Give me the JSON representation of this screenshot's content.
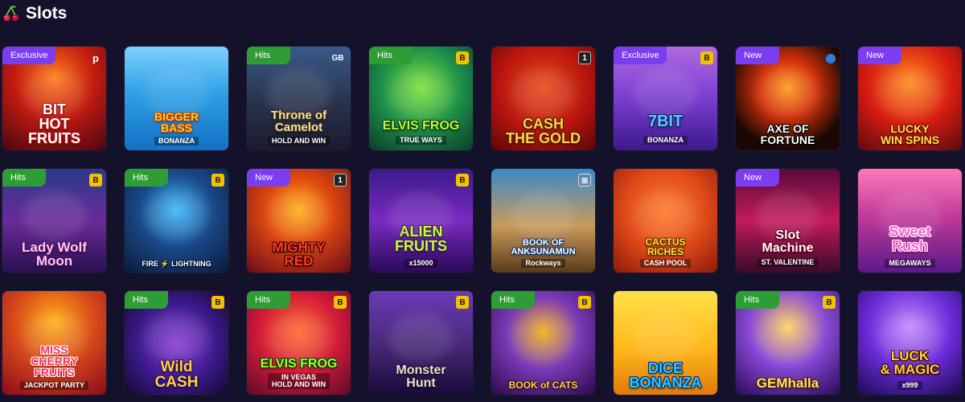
{
  "section": {
    "title": "Slots",
    "icon": "cherry-icon"
  },
  "games": [
    {
      "title": "BIT\nHOT\nFRUITS",
      "subtitle": "",
      "badge": "Exclusive",
      "badge_type": "exclusive",
      "provider_mark": "p",
      "provider_type": "p",
      "bg": "radial-gradient(circle at 50% 30%,#ff7a1a 0%,#c21b10 45%,#4a0612 100%)",
      "title_color": "#ffffff",
      "title_stroke": "#b01010",
      "title_size": "18px"
    },
    {
      "title": "BIGGER\nBASS",
      "subtitle": "BONANZA",
      "badge": "",
      "badge_type": "",
      "provider_mark": "",
      "provider_type": "",
      "bg": "linear-gradient(180deg,#7fd0ff 0%,#2ea0e6 45%,#1270c4 100%)",
      "title_color": "#ffcc33",
      "title_stroke": "#b0400a",
      "title_size": "14px"
    },
    {
      "title": "Throne of\nCamelot",
      "subtitle": "HOLD AND WIN",
      "badge": "Hits",
      "badge_type": "hits",
      "provider_mark": "GB",
      "provider_type": "gb",
      "bg": "linear-gradient(180deg,#3a5a8a 0%,#2a3550 50%,#1a1a2e 100%)",
      "title_color": "#f3e2b0",
      "title_stroke": "#3a2a10",
      "title_size": "15px"
    },
    {
      "title": "ELVIS FROG",
      "subtitle": "TRUE WAYS",
      "badge": "Hits",
      "badge_type": "hits",
      "provider_mark": "B",
      "provider_type": "b",
      "bg": "radial-gradient(circle at 50% 40%,#7ce33a 0%,#1d8f4a 50%,#0d3a2a 100%)",
      "title_color": "#b8ff3a",
      "title_stroke": "#0a3a12",
      "title_size": "16px"
    },
    {
      "title": "CASH\nTHE GOLD",
      "subtitle": "",
      "badge": "",
      "badge_type": "",
      "provider_mark": "1",
      "provider_type": "one",
      "bg": "radial-gradient(circle at 50% 40%,#e84a1a 0%,#b8140e 55%,#5a0608 100%)",
      "title_color": "#ffd34a",
      "title_stroke": "#5a1a00",
      "title_size": "18px"
    },
    {
      "title": "7BIT",
      "subtitle": "BONANZA",
      "badge": "Exclusive",
      "badge_type": "exclusive",
      "provider_mark": "B",
      "provider_type": "b",
      "bg": "linear-gradient(180deg,#b06ae0 0%,#7a3dd0 50%,#3d1a8a 100%)",
      "title_color": "#5ec8ff",
      "title_stroke": "#10206a",
      "title_size": "20px"
    },
    {
      "title": "AXE OF\nFORTUNE",
      "subtitle": "",
      "badge": "New",
      "badge_type": "new",
      "provider_mark": "",
      "provider_type": "dot",
      "bg": "radial-gradient(circle at 50% 40%,#ff9a1a 0%,#d2300a 35%,#1a0804 75%)",
      "title_color": "#ffffff",
      "title_stroke": "#000000",
      "title_size": "14px"
    },
    {
      "title": "LUCKY\nWIN SPINS",
      "subtitle": "",
      "badge": "New",
      "badge_type": "new",
      "provider_mark": "",
      "provider_type": "",
      "bg": "radial-gradient(circle at 50% 35%,#ff8a1a 0%,#d81c12 50%,#5a0a10 100%)",
      "title_color": "#ffe14a",
      "title_stroke": "#6a0a00",
      "title_size": "14px"
    },
    {
      "title": "Lady Wolf\nMoon",
      "subtitle": "",
      "badge": "Hits",
      "badge_type": "hits",
      "provider_mark": "B",
      "provider_type": "b",
      "bg": "linear-gradient(180deg,#2b3a8a 0%,#6a2a9a 50%,#2a1050 100%)",
      "title_color": "#ffc6f0",
      "title_stroke": "#4a1060",
      "title_size": "17px"
    },
    {
      "title": "FIRE ⚡ LIGHTNING",
      "subtitle": "",
      "badge": "Hits",
      "badge_type": "hits",
      "provider_mark": "B",
      "provider_type": "b",
      "bg": "radial-gradient(circle at 50% 40%,#3ab8ff 0%,#1a4a8a 45%,#0a1a3a 100%)",
      "title_color": "#ffffff",
      "title_stroke": "#0a1a3a",
      "title_size": "9px"
    },
    {
      "title": "MIGHTY\nRED",
      "subtitle": "",
      "badge": "New",
      "badge_type": "new",
      "provider_mark": "1",
      "provider_type": "one",
      "bg": "radial-gradient(circle at 50% 40%,#ffb01a 0%,#e04a10 40%,#6a0a1a 100%)",
      "title_color": "#ff3a2a",
      "title_stroke": "#2a0500",
      "title_size": "17px"
    },
    {
      "title": "ALIEN\nFRUITS",
      "subtitle": "x15000",
      "badge": "",
      "badge_type": "",
      "provider_mark": "B",
      "provider_type": "b",
      "bg": "linear-gradient(180deg,#3a1a8a 0%,#7a2ac0 50%,#2a0a5a 100%)",
      "title_color": "#c8ff2a",
      "title_stroke": "#3a1a6a",
      "title_size": "18px"
    },
    {
      "title": "BOOK OF\nANKSUNAMUN",
      "subtitle": "Rockways",
      "badge": "",
      "badge_type": "",
      "provider_mark": "▦",
      "provider_type": "frame",
      "bg": "linear-gradient(180deg,#3a8ac8 0%,#c89a5a 55%,#5a3a1a 100%)",
      "title_color": "#ffffff",
      "title_stroke": "#1a3a6a",
      "title_size": "11px"
    },
    {
      "title": "CACTUS\nRICHES",
      "subtitle": "CASH POOL",
      "badge": "",
      "badge_type": "",
      "provider_mark": "",
      "provider_type": "",
      "bg": "radial-gradient(circle at 50% 40%,#ff7a2a 0%,#e04a1a 50%,#8a1a0a 100%)",
      "title_color": "#ffe03a",
      "title_stroke": "#6a2a00",
      "title_size": "12px"
    },
    {
      "title": "Slot\nMachine",
      "subtitle": "ST. VALENTINE",
      "badge": "New",
      "badge_type": "new",
      "provider_mark": "",
      "provider_type": "",
      "bg": "linear-gradient(180deg,#5a0a3a 0%,#c21a5a 50%,#3a0a2a 100%)",
      "title_color": "#ffffff",
      "title_stroke": "#6a0020",
      "title_size": "16px"
    },
    {
      "title": "Sweet\nRush",
      "subtitle": "MEGAWAYS",
      "badge": "",
      "badge_type": "",
      "provider_mark": "",
      "provider_type": "",
      "bg": "linear-gradient(180deg,#ff7ab8 0%,#c23a9a 45%,#5a1a8a 100%)",
      "title_color": "#ff5ad0",
      "title_stroke": "#ffffff",
      "title_size": "18px"
    },
    {
      "title": "MISS\nCHERRY\nFRUITS",
      "subtitle": "JACKPOT PARTY",
      "badge": "",
      "badge_type": "",
      "provider_mark": "",
      "provider_type": "",
      "bg": "radial-gradient(circle at 50% 30%,#ffb01a 0%,#d84a1a 45%,#8a0a1a 100%)",
      "title_color": "#ff2a5a",
      "title_stroke": "#ffffff",
      "title_size": "14px"
    },
    {
      "title": "Wild\nCASH",
      "subtitle": "",
      "badge": "Hits",
      "badge_type": "hits",
      "provider_mark": "B",
      "provider_type": "b",
      "bg": "radial-gradient(circle at 50% 50%,#8a3ad8 0%,#3a1a8a 55%,#12082a 100%)",
      "title_color": "#ffd23a",
      "title_stroke": "#2a0a6a",
      "title_size": "19px"
    },
    {
      "title": "ELVIS FROG",
      "subtitle": "IN VEGAS\nHOLD AND WIN",
      "badge": "Hits",
      "badge_type": "hits",
      "provider_mark": "B",
      "provider_type": "b",
      "bg": "radial-gradient(circle at 50% 40%,#ff6a2a 0%,#d21a3a 50%,#5a0a2a 100%)",
      "title_color": "#a8ff2a",
      "title_stroke": "#0a3a12",
      "title_size": "16px"
    },
    {
      "title": "Monster\nHunt",
      "subtitle": "",
      "badge": "",
      "badge_type": "",
      "provider_mark": "B",
      "provider_type": "b",
      "bg": "linear-gradient(180deg,#6a3ab8 0%,#4a2a7a 50%,#1a0a3a 100%)",
      "title_color": "#e8e0d0",
      "title_stroke": "#1a1030",
      "title_size": "16px"
    },
    {
      "title": "BOOK of CATS",
      "subtitle": "",
      "badge": "Hits",
      "badge_type": "hits",
      "provider_mark": "B",
      "provider_type": "b",
      "bg": "radial-gradient(circle at 50% 40%,#f0b01a 0%,#7a3ab8 45%,#2a0a4a 100%)",
      "title_color": "#ffd23a",
      "title_stroke": "#3a0a3a",
      "title_size": "12px"
    },
    {
      "title": "DICE\nBONANZA",
      "subtitle": "",
      "badge": "",
      "badge_type": "",
      "provider_mark": "",
      "provider_type": "",
      "bg": "linear-gradient(180deg,#ffe04a 0%,#ffb81a 55%,#e07a0a 100%)",
      "title_color": "#2ac8ff",
      "title_stroke": "#0a2a6a",
      "title_size": "18px"
    },
    {
      "title": "GEMhalla",
      "subtitle": "",
      "badge": "Hits",
      "badge_type": "hits",
      "provider_mark": "B",
      "provider_type": "b",
      "bg": "radial-gradient(circle at 50% 35%,#ffd05a 0%,#8a4ad8 45%,#2a0a5a 100%)",
      "title_color": "#ffe07a",
      "title_stroke": "#4a1a00",
      "title_size": "17px"
    },
    {
      "title": "LUCK\n& MAGIC",
      "subtitle": "x999",
      "badge": "",
      "badge_type": "",
      "provider_mark": "",
      "provider_type": "",
      "bg": "radial-gradient(circle at 50% 35%,#c48aff 0%,#6a2ad8 50%,#1a0a4a 100%)",
      "title_color": "#ffd23a",
      "title_stroke": "#3a0a00",
      "title_size": "17px"
    }
  ]
}
